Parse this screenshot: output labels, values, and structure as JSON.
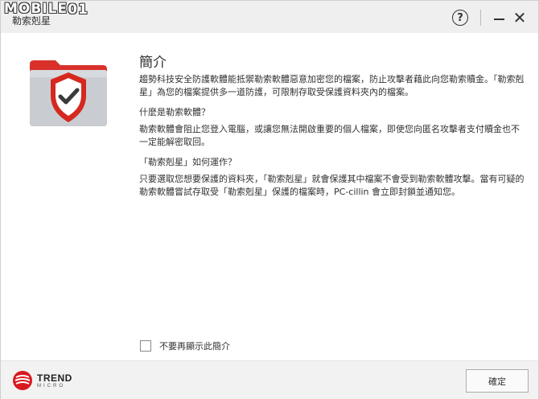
{
  "watermark": {
    "text": "MOBILE",
    "suffix": "01"
  },
  "window": {
    "title": "勒索剋星"
  },
  "titlebar": {
    "help_label": "?",
    "close_label": "✕"
  },
  "intro": {
    "heading": "簡介",
    "body": "趨勢科技安全防護軟體能抵禦勒索軟體惡意加密您的檔案，防止攻擊者藉此向您勒索贖金。「勒索剋星」為您的檔案提供多一道防護，可限制存取受保護資料夾內的檔案。"
  },
  "sections": [
    {
      "question": "什麼是勒索軟體？",
      "answer": "勒索軟體會阻止您登入電腦，或讓您無法開啟重要的個人檔案，即使您向匿名攻擊者支付贖金也不一定能解密取回。"
    },
    {
      "question": "「勒索剋星」如何運作？",
      "answer": "只要選取您想要保護的資料夾，「勒索剋星」就會保護其中檔案不會受到勒索軟體攻擊。當有可疑的勒索軟體嘗試存取受「勒索剋星」保護的檔案時，PC-cillin 會立即封鎖並通知您。"
    }
  ],
  "checkbox": {
    "label": "不要再顯示此簡介",
    "checked": false
  },
  "footer": {
    "logo_line1": "TREND",
    "logo_line2": "MICRO",
    "ok_label": "確定"
  },
  "colors": {
    "shield_red": "#d5281e",
    "folder_red": "#d9312a",
    "folder_gray": "#c9cdd2"
  },
  "icons": [
    "folder-shield-icon",
    "checkmark-icon",
    "help-icon",
    "minimize-icon",
    "close-icon",
    "trend-micro-logo-icon",
    "checkbox-icon"
  ]
}
